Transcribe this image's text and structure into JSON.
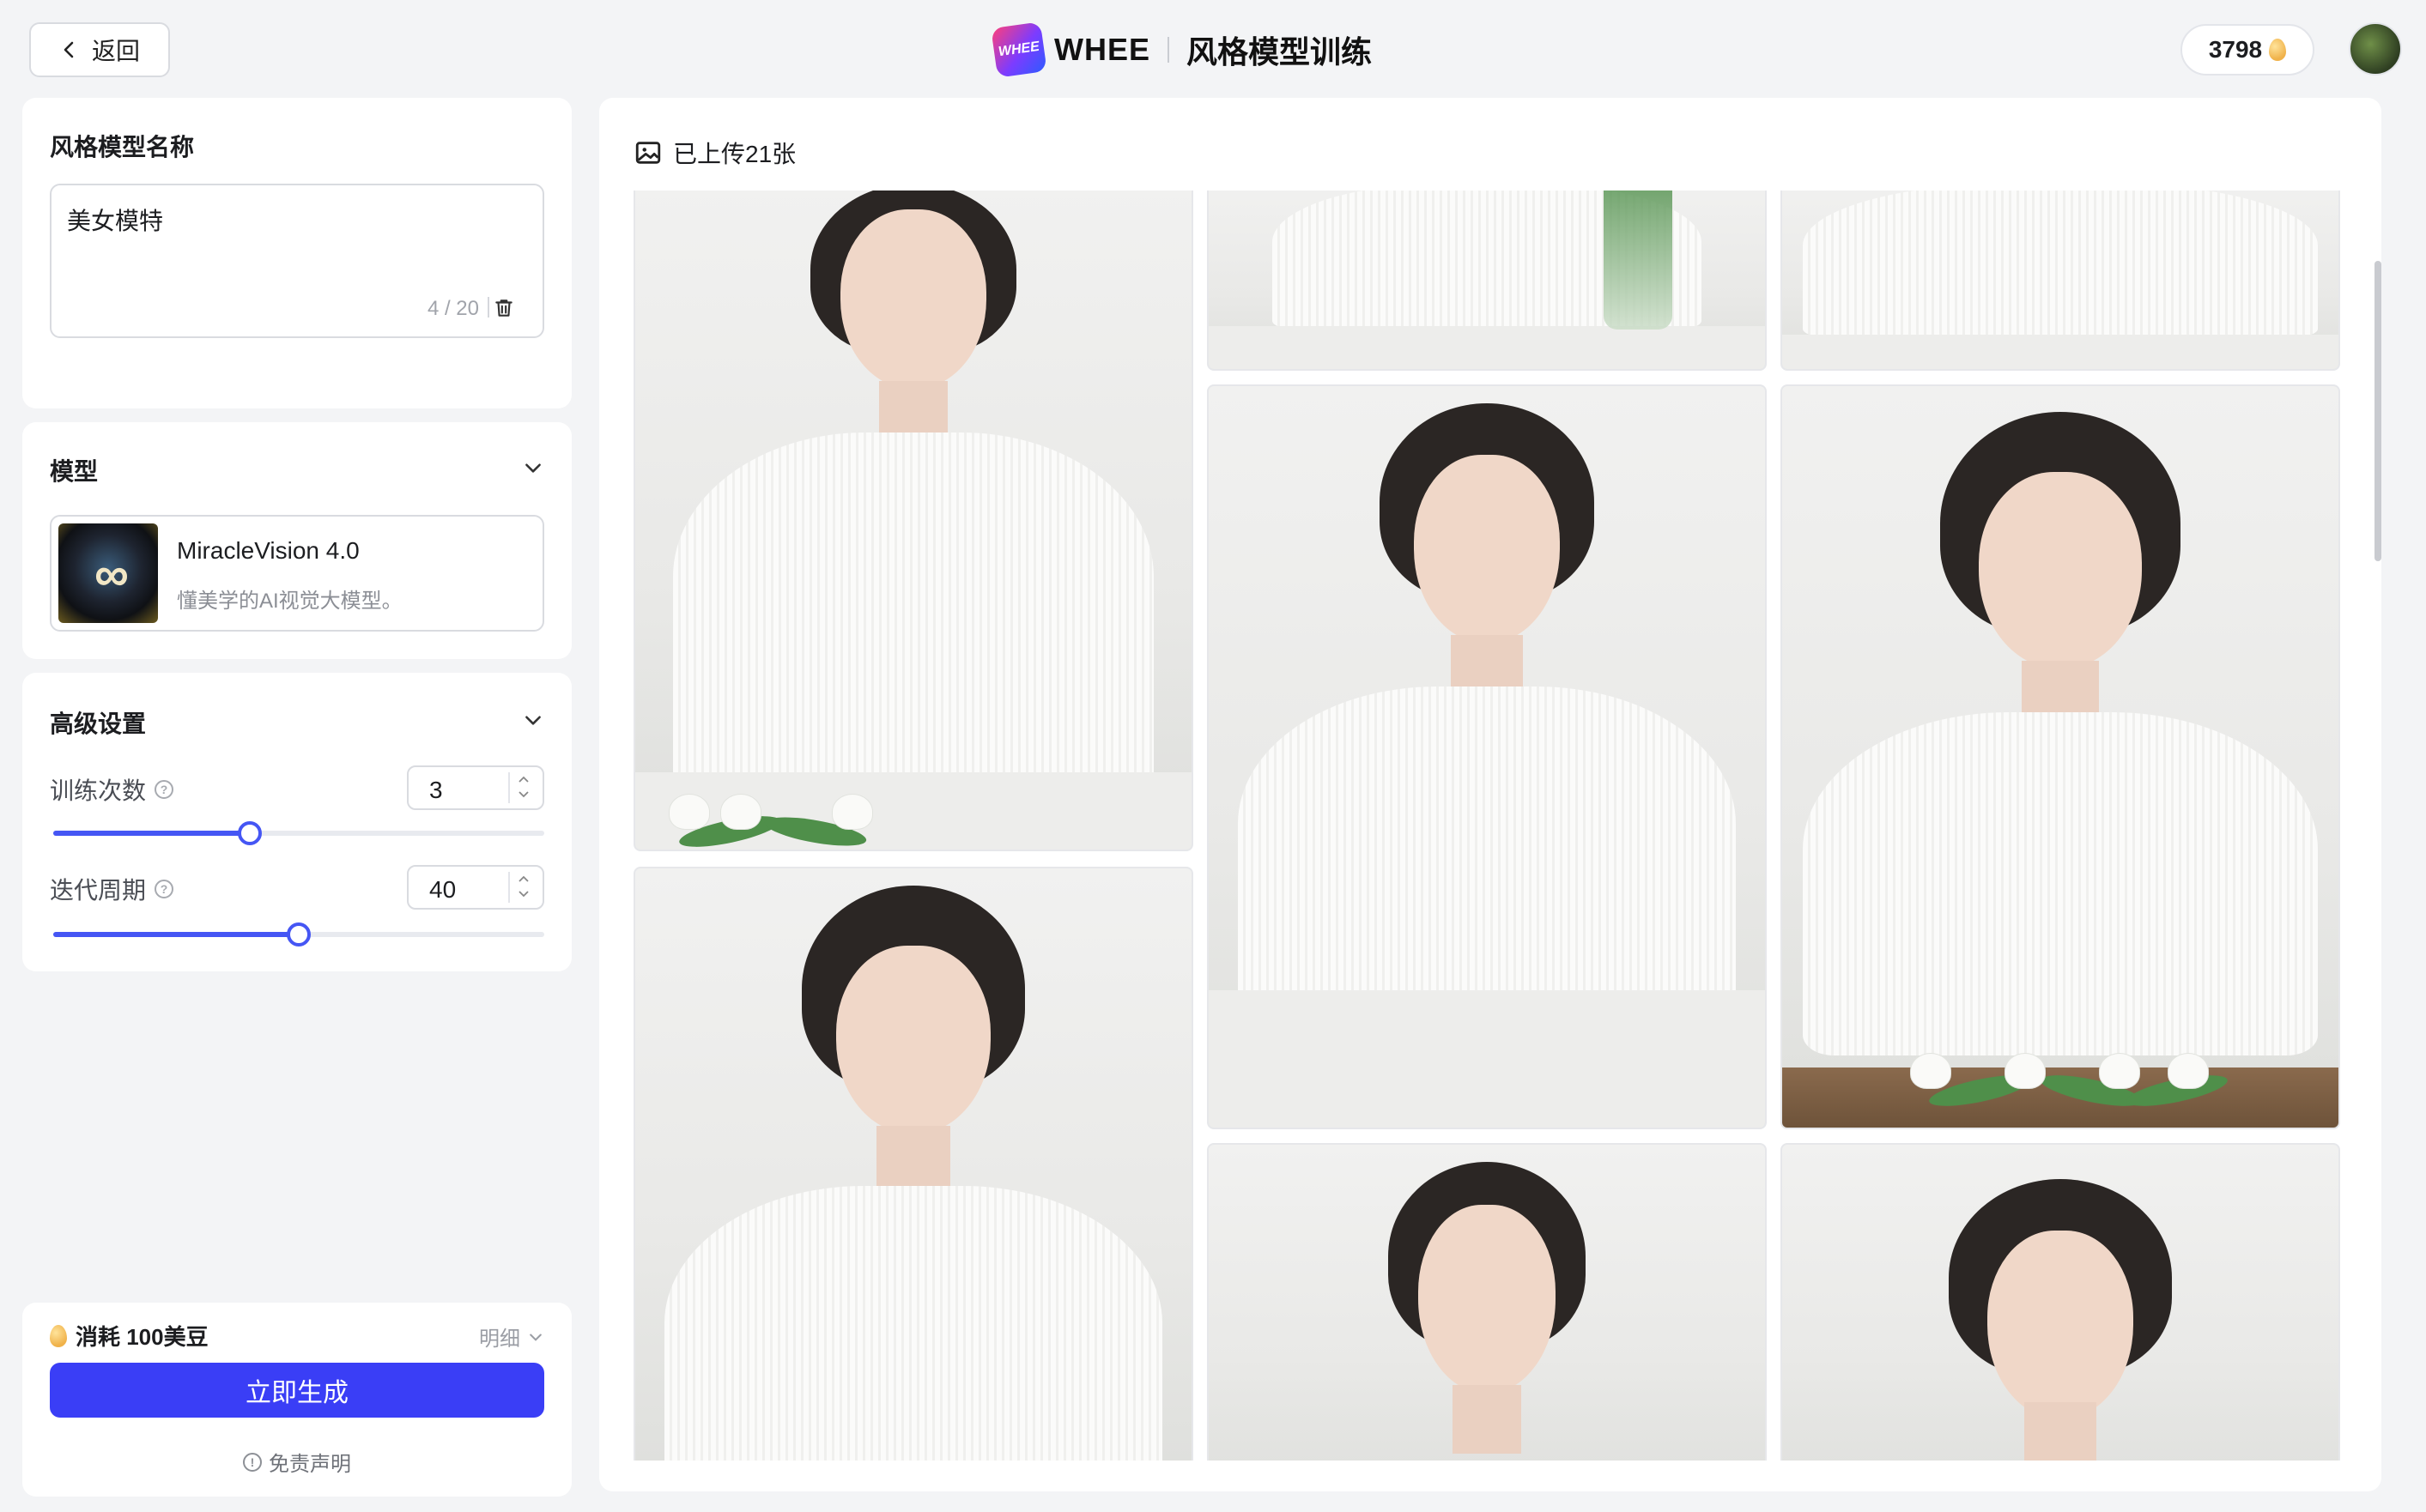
{
  "header": {
    "back_label": "返回",
    "logo_badge": "WHEE",
    "logo_text": "WHEE",
    "page_title": "风格模型训练",
    "credits": "3798"
  },
  "name_section": {
    "title": "风格模型名称",
    "value": "美女模特",
    "count": "4 / 20"
  },
  "model_section": {
    "title": "模型",
    "model_name": "MiracleVision 4.0",
    "model_desc": "懂美学的AI视觉大模型。"
  },
  "advanced_section": {
    "title": "高级设置",
    "train_label": "训练次数",
    "train_value": "3",
    "train_fraction": 0.4,
    "epoch_label": "迭代周期",
    "epoch_value": "40",
    "epoch_fraction": 0.5
  },
  "footer_panel": {
    "cost": "消耗 100美豆",
    "detail": "明细",
    "generate": "立即生成",
    "disclaimer": "免责声明"
  },
  "gallery": {
    "uploaded": "已上传21张",
    "photos": [
      {
        "desc": "portrait-1"
      },
      {
        "desc": "portrait-2"
      },
      {
        "desc": "portrait-3"
      },
      {
        "desc": "portrait-4"
      },
      {
        "desc": "portrait-5"
      },
      {
        "desc": "portrait-6"
      },
      {
        "desc": "portrait-7"
      },
      {
        "desc": "portrait-8"
      }
    ]
  },
  "colors": {
    "accent": "#3a3ef6",
    "slider": "#4556f4",
    "background": "#f3f4f6"
  }
}
